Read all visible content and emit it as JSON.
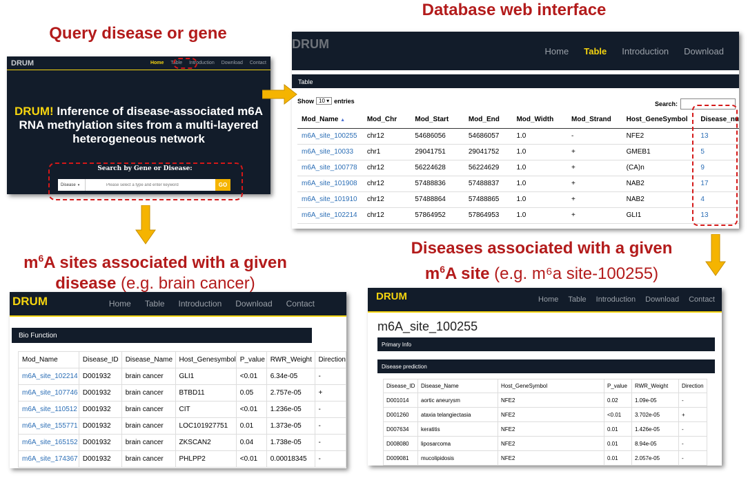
{
  "headings": {
    "query": "Query disease or gene",
    "database": "Database web interface",
    "sites_line1_prefix": "m",
    "sites_line1_sup": "6",
    "sites_line1_rest": "A sites associated with a given",
    "sites_line2_bold": "disease",
    "sites_line2_light": " (e.g. brain cancer)",
    "diseases_line1": "Diseases associated with a given",
    "diseases_line2_prefix": "m",
    "diseases_line2_sup": "6",
    "diseases_line2_bold": "A site",
    "diseases_line2_light": " (e.g. m⁶a site-100255)"
  },
  "nav_items": [
    "Home",
    "Table",
    "Introduction",
    "Download",
    "Contact"
  ],
  "logo": "DRUM",
  "query_panel": {
    "hero_highlight": "DRUM!",
    "hero_rest": " Inference of disease-associated m6A RNA methylation sites from a multi-layered heterogeneous network",
    "search_label": "Search by Gene or Disease:",
    "select_value": "Disease",
    "input_placeholder": "Please select a type and enter keyword",
    "go_label": "GO"
  },
  "table_panel": {
    "bar_title": "Table",
    "show_label": "Show",
    "entries_value": "10",
    "entries_label": "entries",
    "search_label": "Search:",
    "columns": [
      "Mod_Name",
      "Mod_Chr",
      "Mod_Start",
      "Mod_End",
      "Mod_Width",
      "Mod_Strand",
      "Host_GeneSymbol",
      "Disease_nu"
    ],
    "rows": [
      [
        "m6A_site_100255",
        "chr12",
        "54686056",
        "54686057",
        "1.0",
        "-",
        "NFE2",
        "13"
      ],
      [
        "m6A_site_10033",
        "chr1",
        "29041751",
        "29041752",
        "1.0",
        "+",
        "GMEB1",
        "5"
      ],
      [
        "m6A_site_100778",
        "chr12",
        "56224628",
        "56224629",
        "1.0",
        "+",
        "(CA)n",
        "9"
      ],
      [
        "m6A_site_101908",
        "chr12",
        "57488836",
        "57488837",
        "1.0",
        "+",
        "NAB2",
        "17"
      ],
      [
        "m6A_site_101910",
        "chr12",
        "57488864",
        "57488865",
        "1.0",
        "+",
        "NAB2",
        "4"
      ],
      [
        "m6A_site_102214",
        "chr12",
        "57864952",
        "57864953",
        "1.0",
        "+",
        "GLI1",
        "13"
      ]
    ]
  },
  "bio_panel": {
    "bar_title": "Bio Function",
    "columns": [
      "Mod_Name",
      "Disease_ID",
      "Disease_Name",
      "Host_Genesymbol",
      "P_value",
      "RWR_Weight",
      "Direction"
    ],
    "rows": [
      [
        "m6A_site_102214",
        "D001932",
        "brain cancer",
        "GLI1",
        "<0.01",
        "6.34e-05",
        "-"
      ],
      [
        "m6A_site_107746",
        "D001932",
        "brain cancer",
        "BTBD11",
        "0.05",
        "2.757e-05",
        "+"
      ],
      [
        "m6A_site_110512",
        "D001932",
        "brain cancer",
        "CIT",
        "<0.01",
        "1.236e-05",
        "-"
      ],
      [
        "m6A_site_155771",
        "D001932",
        "brain cancer",
        "LOC101927751",
        "0.01",
        "1.373e-05",
        "-"
      ],
      [
        "m6A_site_165152",
        "D001932",
        "brain cancer",
        "ZKSCAN2",
        "0.04",
        "1.738e-05",
        "-"
      ],
      [
        "m6A_site_174367",
        "D001932",
        "brain cancer",
        "PHLPP2",
        "<0.01",
        "0.00018345",
        "-"
      ]
    ]
  },
  "site_panel": {
    "title": "m6A_site_100255",
    "primary_bar": "Primary Info",
    "disease_bar": "Disease prediction",
    "columns": [
      "Disease_ID",
      "Disease_Name",
      "Host_GeneSymbol",
      "P_value",
      "RWR_Weight",
      "Direction"
    ],
    "rows": [
      [
        "D001014",
        "aortic aneurysm",
        "NFE2",
        "0.02",
        "1.09e-05",
        "-"
      ],
      [
        "D001260",
        "ataxia telangiectasia",
        "NFE2",
        "<0.01",
        "3.702e-05",
        "+"
      ],
      [
        "D007634",
        "keratitis",
        "NFE2",
        "0.01",
        "1.426e-05",
        "-"
      ],
      [
        "D008080",
        "liposarcoma",
        "NFE2",
        "0.01",
        "8.94e-05",
        "-"
      ],
      [
        "D009081",
        "mucolipidosis",
        "NFE2",
        "0.01",
        "2.057e-05",
        "-"
      ]
    ]
  },
  "colors": {
    "accent_red": "#b31b1b",
    "nav_bg": "#121c2a",
    "logo_yellow": "#f5d40f",
    "link_blue": "#2a6db5",
    "arrow_orange": "#f5b400"
  }
}
